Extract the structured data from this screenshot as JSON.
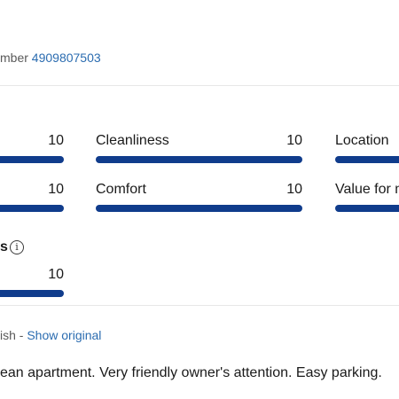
{
  "header": {
    "member_prefix": "mber ",
    "member_number": "4909807503"
  },
  "ratings": {
    "row1": [
      {
        "label": "",
        "score": "10"
      },
      {
        "label": "Cleanliness",
        "score": "10"
      },
      {
        "label": "Location",
        "score": ""
      }
    ],
    "row2": [
      {
        "label": "",
        "score": "10"
      },
      {
        "label": "Comfort",
        "score": "10"
      },
      {
        "label": "Value for m",
        "score": ""
      }
    ],
    "row3": {
      "label": "s",
      "score": "10"
    },
    "bar_color": "#103c8c",
    "bar_fill_fraction": 1.0
  },
  "translation": {
    "prefix": "ish - ",
    "link": "Show original"
  },
  "review": {
    "text": "ean apartment. Very friendly owner's attention. Easy parking."
  },
  "colors": {
    "link": "#2b6cb0",
    "bar": "#103c8c"
  }
}
